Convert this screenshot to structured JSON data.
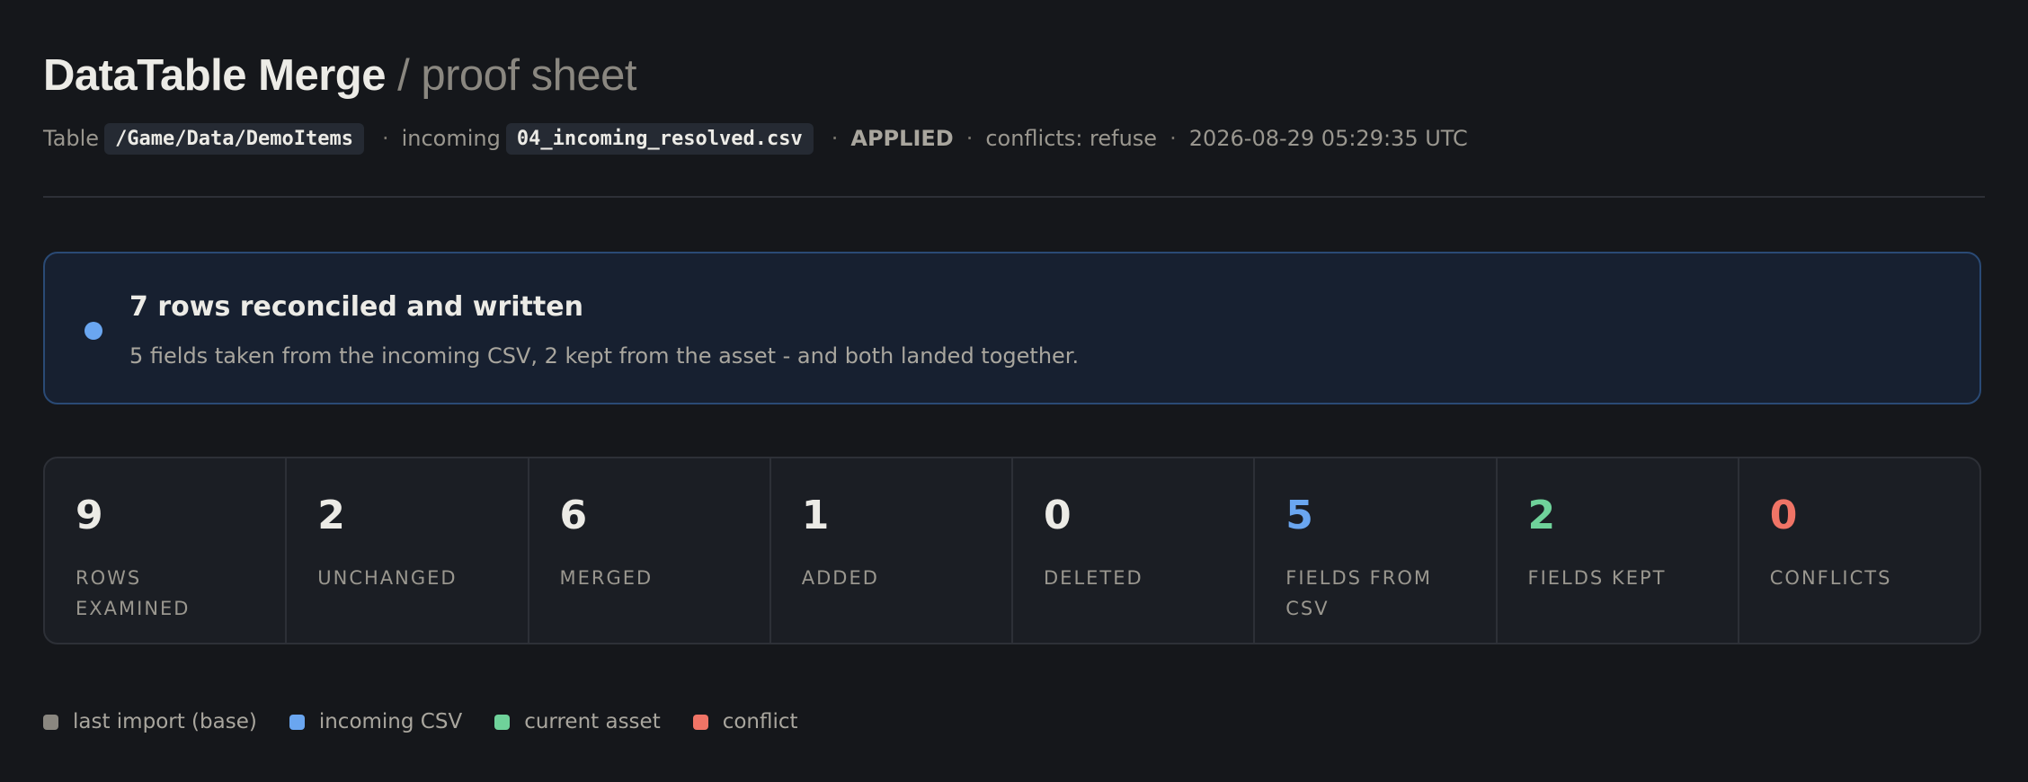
{
  "header": {
    "title": "DataTable Merge",
    "subtitle": "/ proof sheet"
  },
  "meta": {
    "table_label": "Table",
    "table_path": "/Game/Data/DemoItems",
    "incoming_label": "incoming",
    "incoming_file": "04_incoming_resolved.csv",
    "status": "APPLIED",
    "conflicts_policy": "conflicts: refuse",
    "timestamp": "2026-08-29 05:29:35 UTC",
    "separator": "·"
  },
  "banner": {
    "headline": "7 rows reconciled and written",
    "detail": "5 fields taken from the incoming CSV, 2 kept from the asset - and both landed together.",
    "bullet_color": "#6aa6f0"
  },
  "stats": [
    {
      "value": "9",
      "label": "Rows examined",
      "color": "#ecebe6"
    },
    {
      "value": "2",
      "label": "Unchanged",
      "color": "#ecebe6"
    },
    {
      "value": "6",
      "label": "Merged",
      "color": "#ecebe6"
    },
    {
      "value": "1",
      "label": "Added",
      "color": "#ecebe6"
    },
    {
      "value": "0",
      "label": "Deleted",
      "color": "#ecebe6"
    },
    {
      "value": "5",
      "label": "Fields from CSV",
      "color": "#6aa6f0"
    },
    {
      "value": "2",
      "label": "Fields kept",
      "color": "#6fd29a"
    },
    {
      "value": "0",
      "label": "Conflicts",
      "color": "#f07466"
    }
  ],
  "legend": [
    {
      "label": "last import (base)",
      "color": "#8a8780"
    },
    {
      "label": "incoming CSV",
      "color": "#6aa6f0"
    },
    {
      "label": "current asset",
      "color": "#6fd29a"
    },
    {
      "label": "conflict",
      "color": "#f07466"
    }
  ]
}
